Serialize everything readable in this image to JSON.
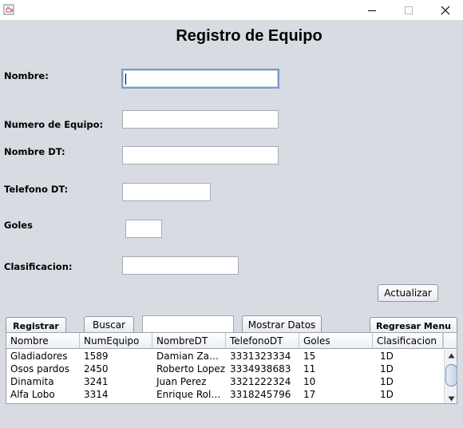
{
  "window": {
    "icon": "java-coffee-icon",
    "controls": [
      "minimize-icon",
      "maximize-icon",
      "close-icon"
    ]
  },
  "form": {
    "title": "Registro de Equipo",
    "labels": {
      "nombre": "Nombre:",
      "numero_equipo": "Numero de Equipo:",
      "nombre_dt": "Nombre DT:",
      "telefono_dt": "Telefono DT:",
      "goles": "Goles",
      "clasificacion": "Clasificacion:"
    },
    "values": {
      "nombre": "",
      "numero_equipo": "",
      "nombre_dt": "",
      "telefono_dt": "",
      "goles": "",
      "clasificacion": "",
      "buscar": ""
    }
  },
  "buttons": {
    "actualizar": "Actualizar",
    "registrar": "Registrar",
    "buscar": "Buscar",
    "mostrar_datos": "Mostrar Datos",
    "regresar_menu": "Regresar Menu"
  },
  "table": {
    "headers": [
      "Nombre",
      "NumEquipo",
      "NombreDT",
      "TelefonoDT",
      "Goles",
      "Clasificacion"
    ],
    "rows": [
      [
        "Gladiadores",
        "1589",
        "Damian Zam...",
        "3331323334",
        "15",
        "1D"
      ],
      [
        "Osos pardos",
        "2450",
        "Roberto Lopez",
        "3334938683",
        "11",
        "1D"
      ],
      [
        "Dinamita",
        "3241",
        "Juan Perez",
        "3321222324",
        "10",
        "1D"
      ],
      [
        "Alfa Lobo",
        "3314",
        "Enrique Rold...",
        "3318245796",
        "17",
        "1D"
      ]
    ]
  }
}
